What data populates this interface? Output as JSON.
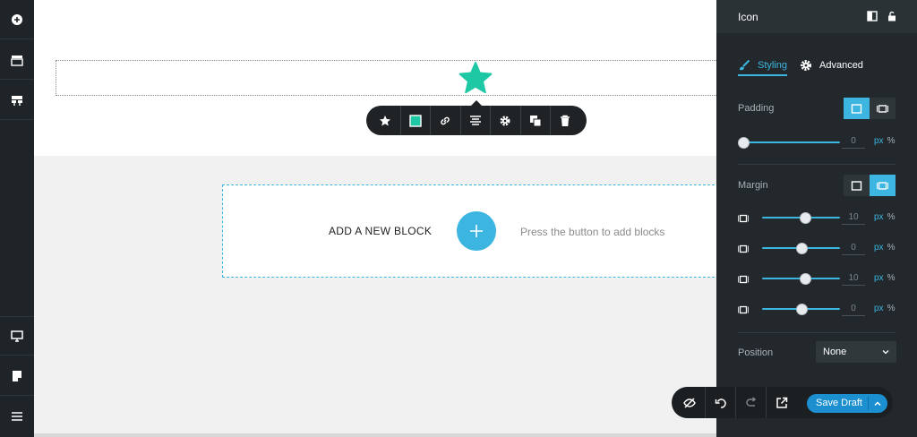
{
  "leftbar": {
    "items_top": [
      {
        "icon": "plus-circle-icon"
      },
      {
        "icon": "layers-icon"
      },
      {
        "icon": "templates-icon"
      }
    ],
    "items_bottom": [
      {
        "icon": "desktop-icon"
      },
      {
        "icon": "notes-icon"
      },
      {
        "icon": "menu-icon"
      }
    ]
  },
  "canvas": {
    "element_icon": "star-icon",
    "element_color": "#1ec8a5",
    "toolbar": [
      "star-icon",
      "color-swatch-icon",
      "link-icon",
      "align-icon",
      "gear-icon",
      "duplicate-icon",
      "trash-icon"
    ],
    "add_block": {
      "label": "ADD A NEW BLOCK",
      "hint": "Press the button to add blocks"
    }
  },
  "panel": {
    "title": "Icon",
    "tabs": [
      {
        "label": "Styling",
        "active": true,
        "icon": "brush-icon"
      },
      {
        "label": "Advanced",
        "active": false,
        "icon": "gear-icon"
      }
    ],
    "padding": {
      "label": "Padding",
      "value": "0",
      "slider_fraction": 0.0,
      "unit_px": "px",
      "unit_pct": "%"
    },
    "margin": {
      "label": "Margin",
      "rows": [
        {
          "side": "top",
          "value": "10",
          "slider_fraction": 0.55
        },
        {
          "side": "right",
          "value": "0",
          "slider_fraction": 0.5
        },
        {
          "side": "bottom",
          "value": "10",
          "slider_fraction": 0.55
        },
        {
          "side": "left",
          "value": "0",
          "slider_fraction": 0.5
        }
      ],
      "unit_px": "px",
      "unit_pct": "%"
    },
    "position": {
      "label": "Position",
      "value": "None"
    }
  },
  "actions": {
    "save_label": "Save Draft",
    "icons": [
      "hide-icon",
      "undo-icon",
      "redo-icon",
      "external-link-icon"
    ]
  },
  "colors": {
    "accent": "#3cb6e0",
    "save": "#1b8fd0",
    "panel_bg": "#22282c"
  }
}
